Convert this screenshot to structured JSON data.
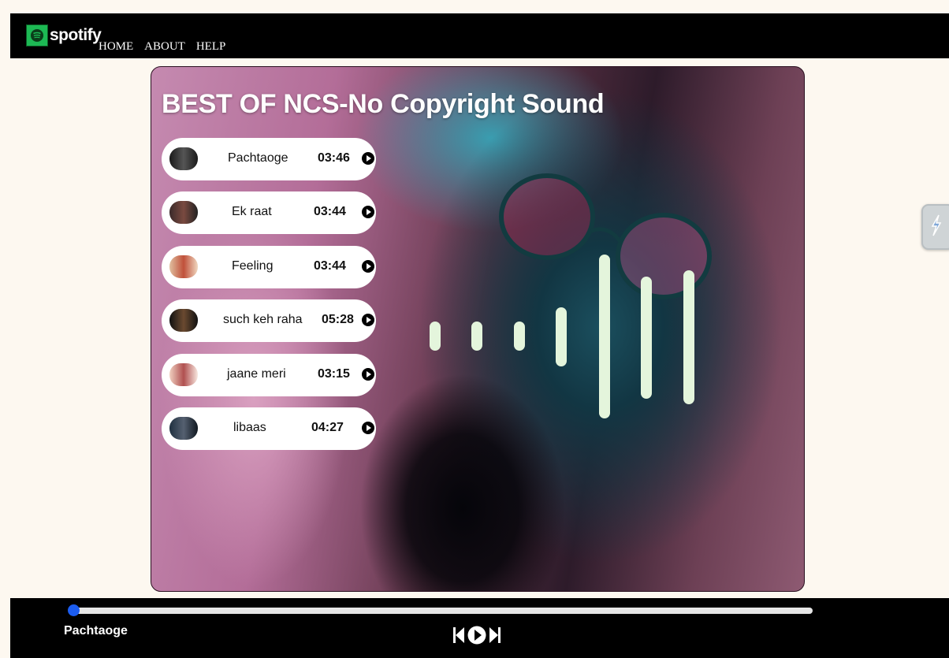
{
  "navbar": {
    "brand": "spotify",
    "links": [
      "HOME",
      "ABOUT",
      "HELP"
    ]
  },
  "hero": {
    "title": "BEST OF NCS-No Copyright Sound"
  },
  "songs": [
    {
      "name": "Pachtaoge",
      "duration": "03:46"
    },
    {
      "name": "Ek raat",
      "duration": "03:44"
    },
    {
      "name": "Feeling",
      "duration": "03:44"
    },
    {
      "name": "such keh raha",
      "duration": "05:28"
    },
    {
      "name": "jaane meri",
      "duration": "03:15"
    },
    {
      "name": "libaas",
      "duration": "04:27"
    }
  ],
  "player": {
    "current_song": "Pachtaoge",
    "progress": 0.0,
    "controls": [
      "previous-icon",
      "play-icon",
      "next-icon"
    ]
  },
  "colors": {
    "accent_blue": "#2f6fe8",
    "brand_green": "#1db954",
    "bar_bg": "#000000",
    "page_bg": "#fdf8f0"
  }
}
